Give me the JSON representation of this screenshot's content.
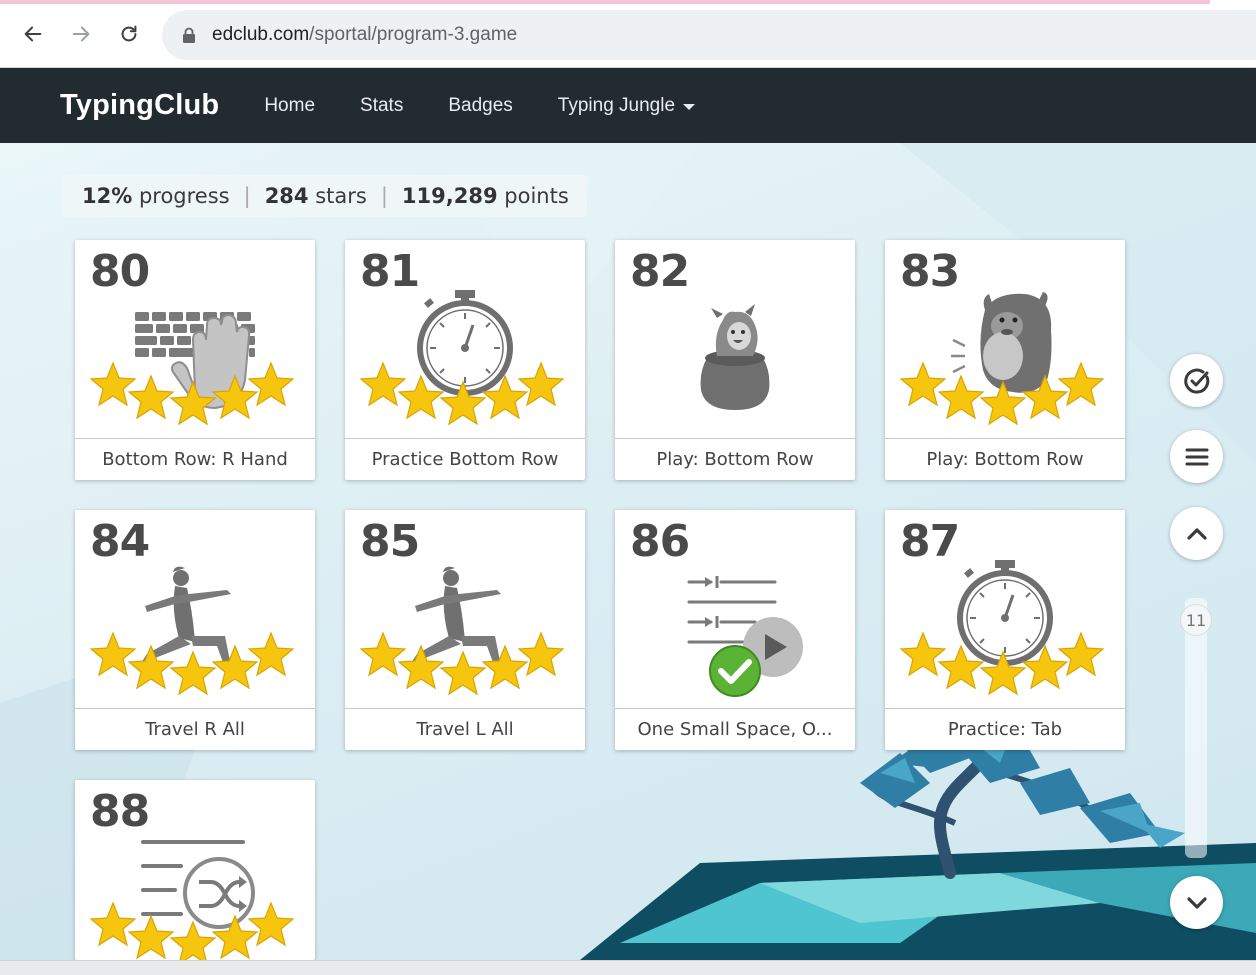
{
  "browser": {
    "url_domain": "edclub.com",
    "url_path": "/sportal/program-3.game",
    "icons": [
      "back-icon",
      "forward-icon",
      "reload-icon",
      "lock-icon"
    ]
  },
  "header": {
    "brand": "TypingClub",
    "nav": [
      {
        "label": "Home"
      },
      {
        "label": "Stats"
      },
      {
        "label": "Badges"
      },
      {
        "label": "Typing Jungle"
      }
    ]
  },
  "stats": {
    "progress_value": "12%",
    "progress_label": "progress",
    "stars_value": "284",
    "stars_label": "stars",
    "points_value": "119,289",
    "points_label": "points",
    "separator": "|"
  },
  "lessons": [
    {
      "number": "80",
      "title": "Bottom Row: R Hand",
      "icon": "keyboard-hand-icon",
      "stars": 5
    },
    {
      "number": "81",
      "title": "Practice Bottom Row",
      "icon": "stopwatch-icon",
      "stars": 5
    },
    {
      "number": "82",
      "title": "Play: Bottom Row",
      "icon": "game-character-icon",
      "stars": 0
    },
    {
      "number": "83",
      "title": "Play: Bottom Row",
      "icon": "monster-icon",
      "stars": 5
    },
    {
      "number": "84",
      "title": "Travel R All",
      "icon": "yoga-pose-icon",
      "stars": 5
    },
    {
      "number": "85",
      "title": "Travel L All",
      "icon": "yoga-pose-icon",
      "stars": 5
    },
    {
      "number": "86",
      "title": "One Small Space, O...",
      "icon": "tab-video-icon",
      "stars": 0,
      "completed": true
    },
    {
      "number": "87",
      "title": "Practice: Tab",
      "icon": "stopwatch-icon",
      "stars": 5
    },
    {
      "number": "88",
      "title": "",
      "icon": "shuffle-text-icon",
      "stars": 5
    }
  ],
  "side_controls": {
    "page_indicator": "11",
    "icons": [
      "check-circle-icon",
      "menu-icon",
      "chevron-up-icon",
      "chevron-down-icon"
    ]
  },
  "colors": {
    "header_bg": "#222b30",
    "star": "#f6c60f",
    "icon_gray": "#7a7a7a",
    "check_green": "#5bb336"
  }
}
